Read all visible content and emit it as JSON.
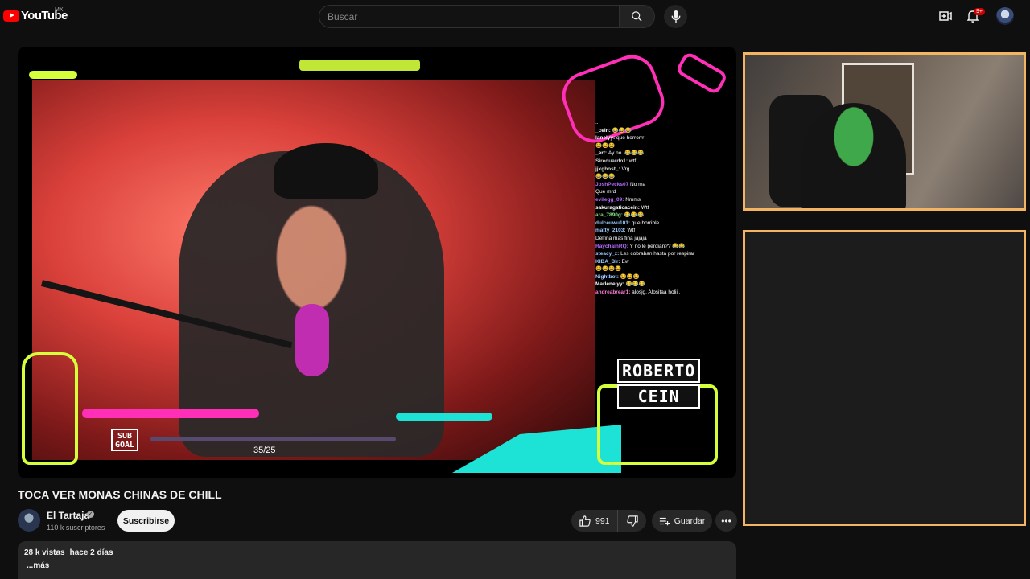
{
  "header": {
    "logo_text": "YouTube",
    "country": "MX",
    "search_placeholder": "Buscar",
    "notifications_badge": "9+"
  },
  "player": {
    "sub_goal_label": "SUB GOAL",
    "sub_goal_progress": "35/25",
    "overlay_brand_line1": "ROBERTO",
    "overlay_brand_line2": "CEIN",
    "chat": [
      {
        "user": "",
        "user_color": "#ffffff",
        "msg": "..."
      },
      {
        "user": "_cein:",
        "user_color": "#ffffff",
        "msg": "😂😂😂"
      },
      {
        "user": "lanelyy:",
        "user_color": "#ffffff",
        "msg": "que horrorrr"
      },
      {
        "user": "",
        "user_color": "#ffffff",
        "msg": "😂😂😂"
      },
      {
        "user": "_ert:",
        "user_color": "#ffffff",
        "msg": "Ay no. 😂😂😂"
      },
      {
        "user": "Sireduardo1:",
        "user_color": "#d9d9d9",
        "msg": "wtf"
      },
      {
        "user": "jjxghost_:",
        "user_color": "#d9d9d9",
        "msg": "Vrg"
      },
      {
        "user": "",
        "user_color": "#ff5a5a",
        "msg": "😂😂😂"
      },
      {
        "user": "JoshPecks07",
        "user_color": "#b66cff",
        "msg": "No ma"
      },
      {
        "user": "",
        "user_color": "#ff5a5a",
        "msg": "Que mrd"
      },
      {
        "user": "evilegg_09:",
        "user_color": "#b66cff",
        "msg": "Nmms"
      },
      {
        "user": "sakuragaticacein:",
        "user_color": "#ffffff",
        "msg": "Wtf"
      },
      {
        "user": "ara_7890g:",
        "user_color": "#7ee081",
        "msg": "😂😂😂"
      },
      {
        "user": "dulceuwu101:",
        "user_color": "#9dcbff",
        "msg": "que horrible"
      },
      {
        "user": "matty_2103:",
        "user_color": "#9dcbff",
        "msg": "Wtf"
      },
      {
        "user": "",
        "user_color": "#ff5a5a",
        "msg": "Delfina mas fina jajaja"
      },
      {
        "user": "RaychainRQ:",
        "user_color": "#b66cff",
        "msg": "Y no le perdian?? 😂😂"
      },
      {
        "user": "steacy_z:",
        "user_color": "#9dcbff",
        "msg": "Les cobraban hasta por respirar"
      },
      {
        "user": "KIBA_Blr:",
        "user_color": "#9dcbff",
        "msg": "Ew"
      },
      {
        "user": "",
        "user_color": "#ffffff",
        "msg": "😂😂😂😂"
      },
      {
        "user": "Nightbot:",
        "user_color": "#9dcbff",
        "msg": "😂😂😂"
      },
      {
        "user": "Marlenelyy:",
        "user_color": "#ffffff",
        "msg": "😂😂😂"
      },
      {
        "user": "andreabrear1:",
        "user_color": "#ff7ad1",
        "msg": "alosjg. Alositaa holiii."
      }
    ]
  },
  "video": {
    "title": "TOCA VER MONAS CHINAS DE CHILL",
    "channel_name": "El Tartaja",
    "subscribers": "110 k suscriptores",
    "subscribe_label": "Suscribirse",
    "like_count": "991",
    "save_label": "Guardar",
    "views": "28 k vistas",
    "date": "hace 2 días",
    "more_label": "...más"
  },
  "colors": {
    "panel_border": "#f4b562",
    "neon_yellow": "#d6ff3b",
    "neon_pink": "#ff2fb8",
    "neon_cyan": "#1de3d7"
  }
}
